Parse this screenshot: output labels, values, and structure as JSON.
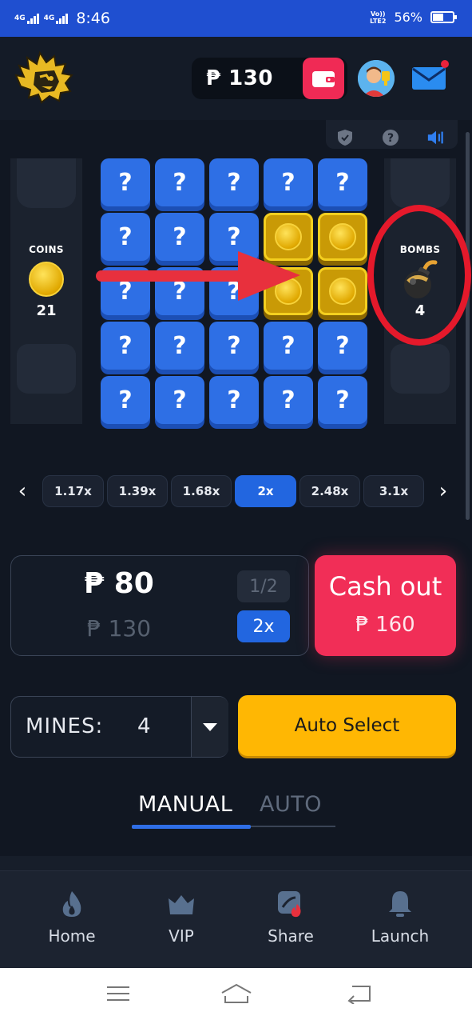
{
  "status_bar": {
    "net1": "4G",
    "net2": "4G",
    "time": "8:46",
    "volte_line1": "Vo))",
    "volte_line2": "LTE2",
    "battery_percent": "56%",
    "battery_level": 0.56
  },
  "header": {
    "currency_symbol": "₱",
    "balance": "130",
    "icons": [
      "lion-logo",
      "wallet-icon",
      "avatar",
      "mail-icon"
    ]
  },
  "game": {
    "top_icons": [
      "shield-icon",
      "help-icon",
      "sound-icon"
    ],
    "coins_panel": {
      "label": "COINS",
      "count": "21"
    },
    "bombs_panel": {
      "label": "BOMBS",
      "count": "4"
    },
    "grid": [
      [
        "?",
        "?",
        "?",
        "?",
        "?"
      ],
      [
        "?",
        "?",
        "?",
        "coin",
        "coin"
      ],
      [
        "?",
        "?",
        "?",
        "coin",
        "coin"
      ],
      [
        "?",
        "?",
        "?",
        "?",
        "?"
      ],
      [
        "?",
        "?",
        "?",
        "?",
        "?"
      ]
    ],
    "tile_hidden_symbol": "?"
  },
  "multipliers": {
    "items": [
      "1.17x",
      "1.39x",
      "1.68x",
      "2x",
      "2.48x",
      "3.1x"
    ],
    "active_index": 3,
    "prev_symbol": "‹",
    "next_symbol": "›"
  },
  "bet": {
    "amount": "₱ 80",
    "balance_sub": "₱ 130",
    "half_label": "1/2",
    "double_label": "2x"
  },
  "cashout": {
    "label": "Cash out",
    "amount": "₱ 160"
  },
  "mines": {
    "label": "MINES:",
    "value": "4",
    "auto_select_label": "Auto Select"
  },
  "tabs": {
    "manual": "MANUAL",
    "auto": "AUTO",
    "active": "manual"
  },
  "bottom_nav": [
    {
      "label": "Home",
      "icon": "flame-icon"
    },
    {
      "label": "VIP",
      "icon": "crown-icon"
    },
    {
      "label": "Share",
      "icon": "share-icon"
    },
    {
      "label": "Launch",
      "icon": "bell-icon"
    }
  ],
  "colors": {
    "accent_blue": "#2266e0",
    "cashout_red": "#f12e57",
    "auto_select_yellow": "#ffb703",
    "status_bar_blue": "#1f4fd0"
  }
}
